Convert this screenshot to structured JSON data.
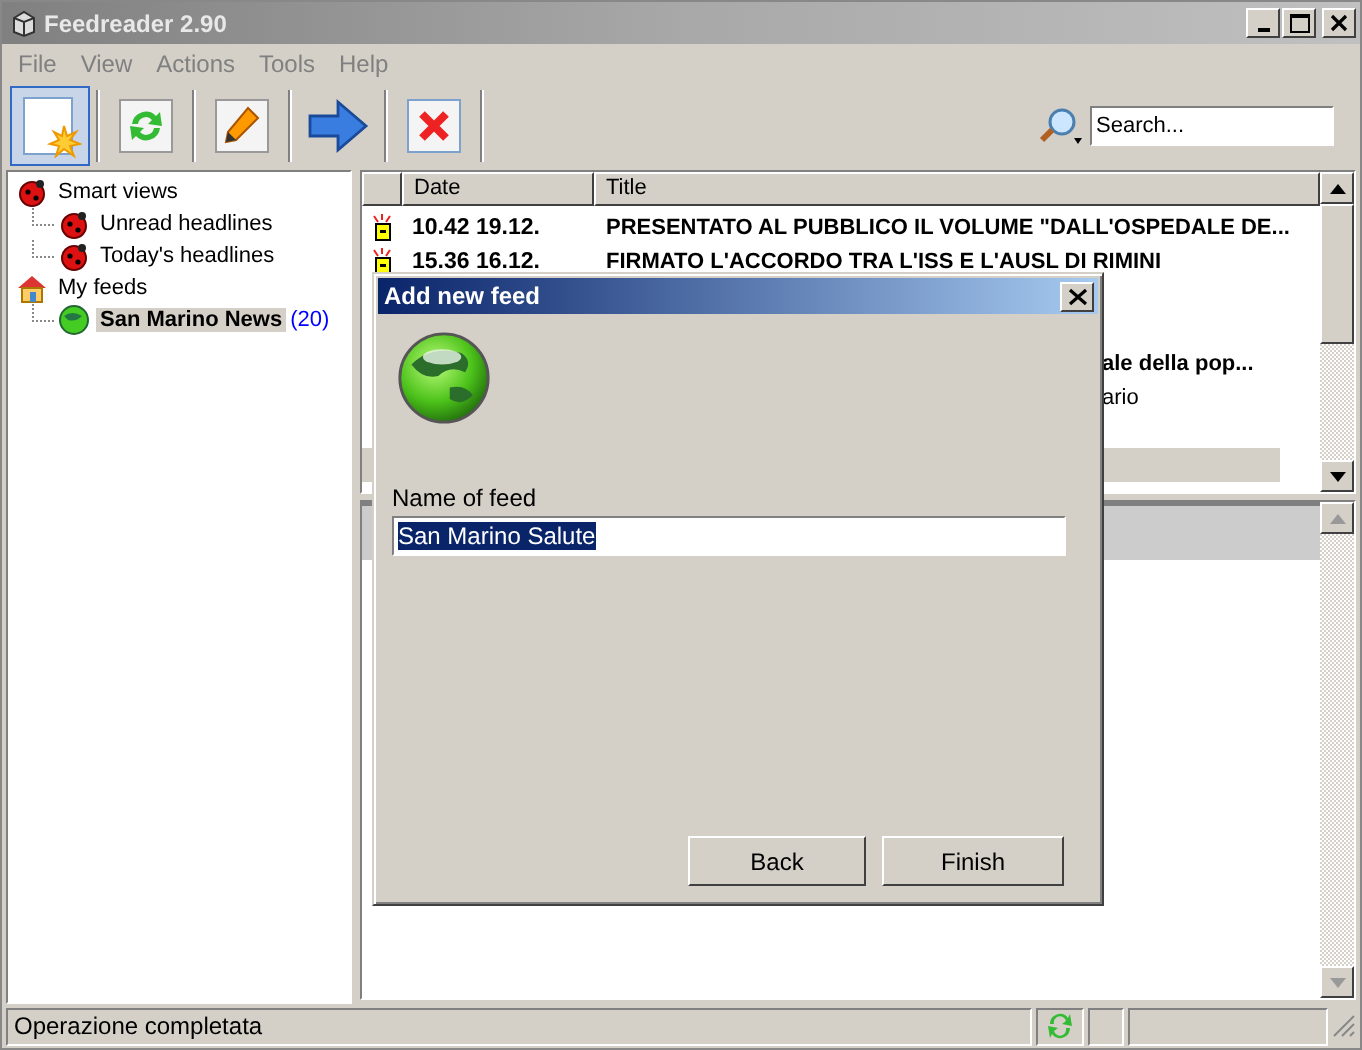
{
  "window": {
    "title": "Feedreader 2.90"
  },
  "menu": [
    "File",
    "View",
    "Actions",
    "Tools",
    "Help"
  ],
  "toolbar": [
    {
      "kind": "new",
      "pressed": true
    },
    {
      "kind": "refresh",
      "pressed": false
    },
    {
      "kind": "edit",
      "pressed": false
    },
    {
      "kind": "next",
      "pressed": false
    },
    {
      "kind": "delete",
      "pressed": false
    }
  ],
  "search": {
    "placeholder": "Search..."
  },
  "tree": [
    {
      "label": "Smart views",
      "kind": "smart",
      "selected": false,
      "children": [
        {
          "label": "Unread headlines",
          "kind": "smart",
          "selected": false
        },
        {
          "label": "Today's headlines",
          "kind": "smart",
          "selected": false
        }
      ]
    },
    {
      "label": "My feeds",
      "kind": "home",
      "selected": false,
      "children": [
        {
          "label": "San Marino News",
          "count": "(20)",
          "kind": "feed",
          "selected": true
        }
      ]
    }
  ],
  "headlines": {
    "columns": [
      "Date",
      "Title"
    ],
    "rows": [
      {
        "kind": "full",
        "new": true,
        "unread": true,
        "selected": false,
        "date": "10.42 19.12.",
        "title": "PRESENTATO AL PUBBLICO IL VOLUME \"DALL'OSPEDALE DE..."
      },
      {
        "kind": "full",
        "new": true,
        "unread": true,
        "selected": false,
        "date": "15.36 16.12.",
        "title": "FIRMATO L'ACCORDO TRA L'ISS E L'AUSL DI RIMINI"
      },
      {
        "kind": "tail",
        "unread": true,
        "selected": false,
        "title": "ale della pop..."
      },
      {
        "kind": "tail",
        "unread": false,
        "selected": false,
        "title": "ario"
      },
      {
        "kind": "tail",
        "selected": true
      }
    ]
  },
  "dialog": {
    "title": "Add new feed",
    "label": "Name of feed",
    "value": "San Marino Salute",
    "buttons": [
      "Back",
      "Finish"
    ]
  },
  "status_bar": {
    "text": "Operazione completata"
  }
}
